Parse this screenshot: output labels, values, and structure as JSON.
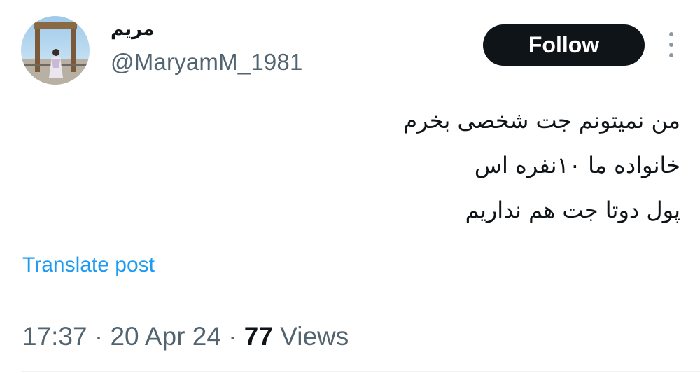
{
  "author": {
    "display_name": "مریم",
    "handle": "@MaryamM_1981"
  },
  "header": {
    "follow_label": "Follow"
  },
  "tweet": {
    "lines": [
      "من نمیتونم جت شخصی بخرم",
      "خانواده ما ۱۰نفره اس",
      "پول دوتا جت هم نداریم"
    ],
    "translate_label": "Translate post",
    "time": "17:37",
    "separator": "·",
    "date": "20 Apr 24",
    "views_count": "77",
    "views_label": "Views"
  },
  "colors": {
    "accent": "#1d9bf0",
    "button_bg": "#0f1419",
    "secondary_text": "#536471"
  },
  "icons": {
    "more": "more-vertical-icon",
    "avatar": "avatar-photo"
  }
}
